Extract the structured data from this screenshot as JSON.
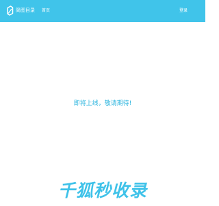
{
  "header": {
    "logo_text": "简图目录",
    "nav_home": "首页",
    "login": "登录",
    "background_color": "#40c4ea"
  },
  "main": {
    "message": "即将上线，敬请期待!"
  },
  "footer": {
    "banner_text": "千狐秒收录",
    "banner_color": "#3fc2e9"
  }
}
